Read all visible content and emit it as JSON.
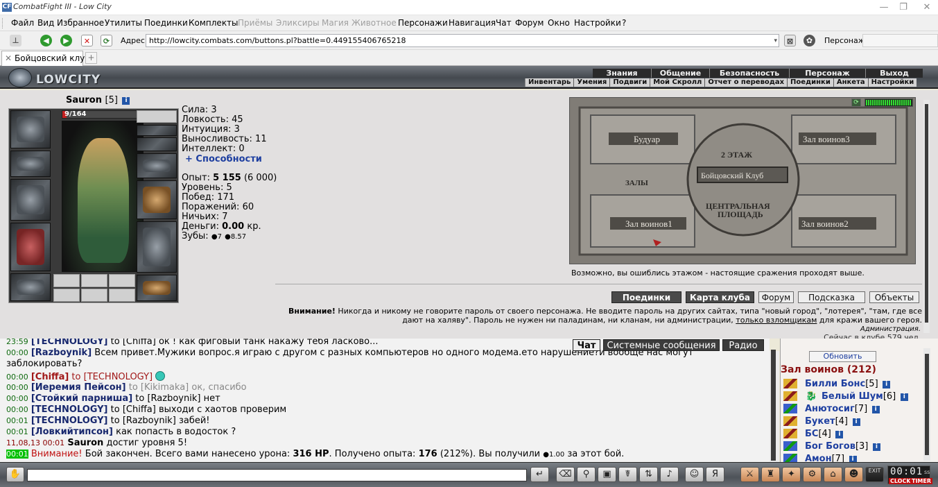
{
  "window": {
    "title": "CombatFight III - Low City",
    "app_icon": "CF",
    "controls": [
      "minimize-icon",
      "maximize-icon",
      "close-icon"
    ]
  },
  "menu": {
    "items": [
      {
        "label": "Файл",
        "enabled": true
      },
      {
        "label": "Вид",
        "enabled": true
      },
      {
        "label": "Избранное",
        "enabled": true
      },
      {
        "label": "Утилиты",
        "enabled": true
      },
      {
        "label": "Поединки",
        "enabled": true
      },
      {
        "label": "Комплекты",
        "enabled": true
      },
      {
        "label": "Приёмы",
        "enabled": false
      },
      {
        "label": "Эликсиры",
        "enabled": false
      },
      {
        "label": "Магия",
        "enabled": false
      },
      {
        "label": "Животное",
        "enabled": false
      },
      {
        "label": "Персонажи",
        "enabled": true
      },
      {
        "label": "Навигация",
        "enabled": true
      },
      {
        "label": "Чат",
        "enabled": true
      },
      {
        "label": "Форум",
        "enabled": true
      },
      {
        "label": "Окно",
        "enabled": true
      },
      {
        "label": "Настройки",
        "enabled": true
      },
      {
        "label": "?",
        "enabled": true
      }
    ]
  },
  "toolbar": {
    "address_label": "Адрес:",
    "address_value": "http://lowcity.combats.com/buttons.pl?battle=0.449155406765218",
    "character_label": "Персонаж:",
    "icons": [
      "pin-icon",
      "back-icon",
      "forward-icon",
      "stop-icon",
      "refresh-icon"
    ]
  },
  "tabs": [
    {
      "label": "Бойцовский клуб"
    }
  ],
  "header": {
    "logo_text": "LOWCITY",
    "nav_top": [
      "Знания",
      "Общение",
      "Безопасность",
      "Персонаж",
      "Выход"
    ],
    "nav_bottom": [
      "Инвентарь",
      "Умения",
      "Подвиги",
      "Мой Скролл",
      "Отчет о переводах",
      "Поединки",
      "Анкета",
      "Настройки"
    ]
  },
  "character": {
    "name": "Sauron",
    "level": "[5]",
    "hp_text": "9/164",
    "hp_fraction": 0.055,
    "stats": [
      "Сила: 3",
      "Ловкость: 45",
      "Интуиция: 3",
      "Выносливость: 11",
      "Интеллект: 0"
    ],
    "abilities_link": "+ Способности",
    "exp_label": "Опыт:",
    "exp_value": "5 155",
    "exp_next": "(6 000)",
    "level_line": "Уровень: 5",
    "wins_line": "Побед: 171",
    "losses_line": "Поражений: 60",
    "draws_line": "Ничьих: 7",
    "money_label": "Деньги:",
    "money_value": "0.00",
    "money_unit": "кр.",
    "teeth_label": "Зубы:",
    "teeth_a": "7",
    "teeth_b": "8.57"
  },
  "map": {
    "labels": [
      "Будуар",
      "Зал воинов3",
      "2 ЭТАЖ",
      "Бойцовский Клуб",
      "ЗАЛЫ",
      "ЦЕНТРАЛЬНАЯ",
      "ПЛОЩАДЬ",
      "Зал воинов1",
      "Зал воинов2"
    ],
    "caption": "Возможно, вы ошиблись этажом - настоящие сражения проходят выше.",
    "online_fraction": 1.0
  },
  "actions": {
    "buttons": [
      "Поединки",
      "Карта клуба",
      "Форум",
      "Подсказка",
      "Объекты"
    ]
  },
  "warning": {
    "bold": "Внимание!",
    "text_before_link": " Никогда и никому не говорите пароль от своего персонажа. Не вводите пароль на других сайтах, типа \"новый город\", \"лотерея\", \"там, где все дают на халяву\". Пароль не нужен ни паладинам, ни кланам, ни администрации,",
    "link": "только взломщикам",
    "text_after_link": " для кражи вашего героя.",
    "admin": "Администрация.",
    "online_cut": "Сейчас в клубе 579 чел."
  },
  "chat": {
    "tabs": [
      "Чат",
      "Системные сообщения",
      "Радио"
    ],
    "lines": [
      {
        "time": "23:59",
        "from": "[TECHNOLOGY]",
        "to": "to [Chiffa]",
        "text": "ок ! как фиговый танк накажу тебя ласково..."
      },
      {
        "time": "00:00",
        "from": "[Razboynik]",
        "text": "Всем привет.Мужики вопрос.я играю с другом с разных компьютеров но одного модема.ето нарушение?и вообще нас могут",
        "text2": "заблокировать?"
      },
      {
        "time": "00:00",
        "from": "[Chiffa]",
        "to": "to",
        "to2": "[TECHNOLOGY]"
      },
      {
        "time": "00:00",
        "from": "[Иеремия Пейсон]",
        "to": "to [Kikimaka]",
        "text": "ок, спасибо"
      },
      {
        "time": "00:00",
        "from": "[Стойкий парнишa]",
        "to": "to [Razboynik]",
        "text": "нет"
      },
      {
        "time": "00:00",
        "from": "[TECHNOLOGY]",
        "to": "to [Chiffa]",
        "text": "выходи с хаотов проверим"
      },
      {
        "time": "00:01",
        "from": "[TECHNOLOGY]",
        "to": "to [Razboynik]",
        "text": "забей!"
      },
      {
        "time": "00:01",
        "from": "[Ловкийтипсон]",
        "text": "как попасть в водосток ?"
      },
      {
        "time": "11,08,13 00:01",
        "from": "Sauron",
        "text": "достиг уровня 5!"
      },
      {
        "time": "00:01",
        "warn": "Внимание!",
        "text": "Бой закончен. Всего вами нанесено урона:",
        "dmg": "316 HP",
        "text2": ". Получено опыта:",
        "exp": "176",
        "text3": "(212%). Вы получили",
        "coin": "1.00",
        "text4": "за этот бой."
      }
    ]
  },
  "room": {
    "refresh_label": "Обновить",
    "title": "Зал воинов (212)",
    "users": [
      {
        "name": "Билли Бонс",
        "level": "[5]",
        "icon": "warrior-icon"
      },
      {
        "name": "Белый Шум",
        "level": "[6]",
        "icon": "warrior-icon"
      },
      {
        "name": "Анютосиг",
        "level": "[7]",
        "icon": "mage-icon"
      },
      {
        "name": "Букет",
        "level": "[4]",
        "icon": "warrior-icon"
      },
      {
        "name": "БС",
        "level": "[4]",
        "icon": "warrior-icon"
      },
      {
        "name": "Бог Богов",
        "level": "[3]",
        "icon": "mage-icon"
      },
      {
        "name": "Амон",
        "level": "[7]",
        "icon": "mage-icon"
      }
    ]
  },
  "bottombar": {
    "clock_value": "00:01",
    "clock_suffix": "ss",
    "clock_label": "CLOCK",
    "timer_label": "TIMER",
    "exit_label": "EXIT"
  }
}
